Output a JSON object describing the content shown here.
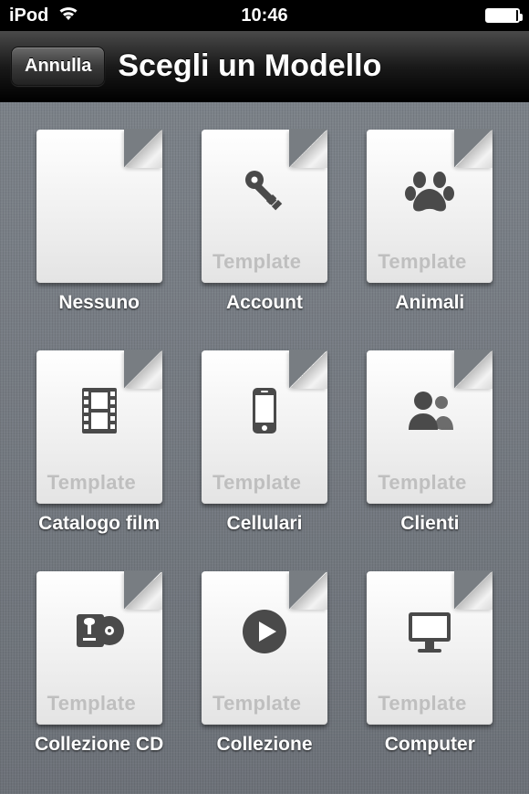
{
  "status": {
    "carrier": "iPod",
    "time": "10:46"
  },
  "navbar": {
    "cancel_label": "Annulla",
    "title": "Scegli un Modello"
  },
  "page_badge": "Template",
  "templates": [
    {
      "label": "Nessuno",
      "icon": "none",
      "blank": true
    },
    {
      "label": "Account",
      "icon": "key"
    },
    {
      "label": "Animali",
      "icon": "paw"
    },
    {
      "label": "Catalogo film",
      "icon": "film"
    },
    {
      "label": "Cellulari",
      "icon": "phone"
    },
    {
      "label": "Clienti",
      "icon": "people"
    },
    {
      "label": "Collezione CD",
      "icon": "cd"
    },
    {
      "label": "Collezione",
      "icon": "play"
    },
    {
      "label": "Computer",
      "icon": "computer"
    }
  ]
}
